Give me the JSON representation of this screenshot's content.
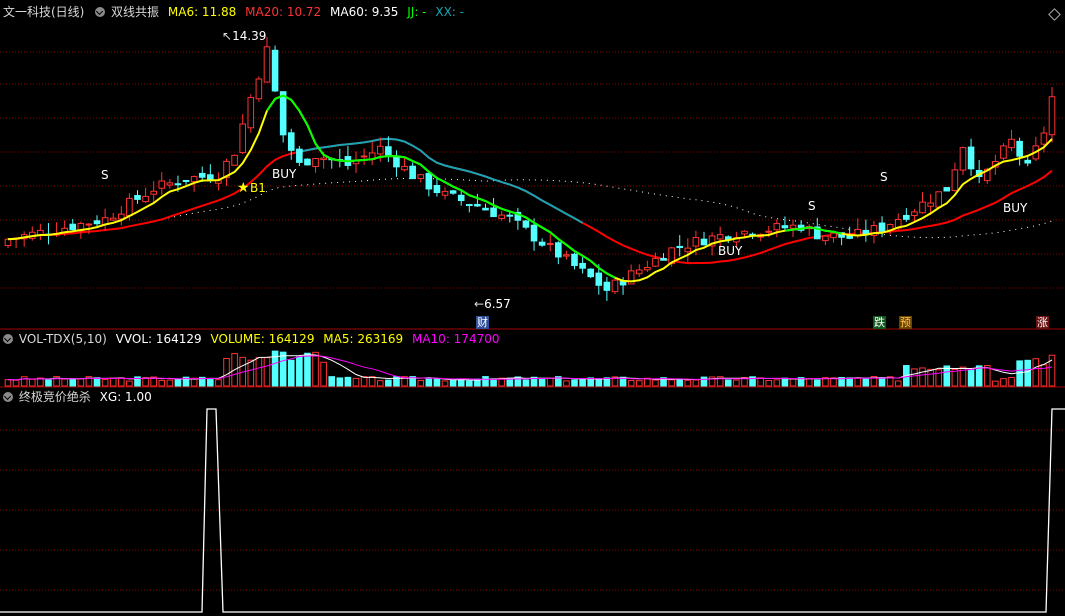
{
  "main_panel": {
    "title": "文一科技(日线)",
    "indicator": "双线共振",
    "ma6_label": "MA6: 11.88",
    "ma20_label": "MA20: 10.72",
    "ma60_label": "MA60: 9.35",
    "jj_label": "JJ: -",
    "xx_label": "XX: -",
    "high_label": "14.39",
    "low_label": "6.57",
    "signals": {
      "s1": "S",
      "s2": "S",
      "s3": "S",
      "star": "★",
      "b1": "B1",
      "buy1": "BUY",
      "buy2": "BUY",
      "buy3": "BUY"
    },
    "badges": {
      "cai": "财",
      "die": "跌",
      "yu": "预",
      "zhang": "涨"
    }
  },
  "volume_panel": {
    "title": "VOL-TDX(5,10)",
    "vvol_label": "VVOL: 164129",
    "volume_label": "VOLUME: 164129",
    "ma5_label": "MA5: 263169",
    "ma10_label": "MA10: 174700"
  },
  "xg_panel": {
    "title": "终极竞价绝杀",
    "xg_label": "XG: 1.00"
  },
  "colors": {
    "up": "#ff3232",
    "down": "#54ffff",
    "ma6": "#ffff00",
    "ma20": "#ff0000",
    "ma60": "#ffffff",
    "jj": "#00ff00",
    "xx": "#17a5b5",
    "grid": "#8b0000",
    "panel_line": "#a00000",
    "text": "#c0c0c0",
    "ma10_color": "#ff00ff"
  },
  "icons": [
    "settings-circle-icon",
    "diamond-icon"
  ],
  "chart_data": {
    "type": "candlestick",
    "high_marker": 14.39,
    "low_marker": 6.57,
    "xg_signal": [
      1,
      0,
      1
    ],
    "ma_last": {
      "MA6": 11.88,
      "MA20": 10.72,
      "MA60": 9.35
    },
    "volume_last": {
      "VVOL": 164129,
      "VOLUME": 164129,
      "MA5": 263169,
      "MA10": 174700
    }
  }
}
